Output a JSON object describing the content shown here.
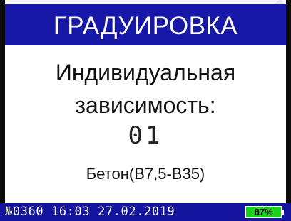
{
  "header": {
    "title": "ГРАДУИРОВКА"
  },
  "main": {
    "line1": "Индивидуальная",
    "line2": "зависимость:",
    "number": "01",
    "material": "Бетон(В7,5-В35)"
  },
  "status_bar": {
    "text": "№0360 16:03 27.02.2019",
    "battery_label": "87%",
    "battery_level": 0.87
  },
  "colors": {
    "header_bg": "#1717a8",
    "status_bg": "#1515a0",
    "battery_fill": "#1ad21a"
  },
  "icons": {
    "battery": "battery-icon"
  }
}
